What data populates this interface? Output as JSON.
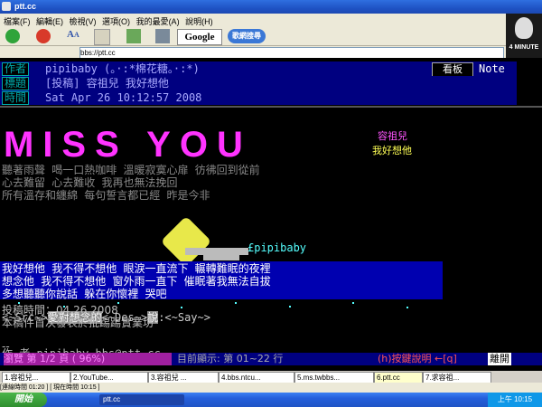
{
  "window": {
    "title": "ptt.cc"
  },
  "menu": [
    "檔案(F)",
    "編輯(E)",
    "檢視(V)",
    "選項(O)",
    "我的最愛(A)",
    "說明(H)"
  ],
  "toolbar": {
    "google": "Google",
    "web_search": "歌網搜尋"
  },
  "address": {
    "value": "bbs://ptt.cc"
  },
  "brand": {
    "text": "4 MINUTE"
  },
  "post": {
    "author_label": "作者",
    "author": "pipibaby (。·:*棉花糖。·:*)",
    "board_button": "看板",
    "board": "Note",
    "title_label": "標題",
    "title": "[投稿] 容祖兒 我好想他",
    "time_label": "時間",
    "time": "Sat Apr 26 10:12:57 2008"
  },
  "art": {
    "big": "MISS YOU",
    "song1": "容祖兒",
    "song2": "我好想他",
    "signature": "£pipibaby",
    "lines": [
      "聽著雨聲   喝一口熱咖啡                    溫暖寂寞心扉   彷彿回到從前",
      "心去難留   心去難收                        我再也無法挽回",
      "所有溫存和纏綿                            每句誓言都已經   昨是今非",
      "我好想他   我不得不想他            眼淚一直流下   輾轉難眠的夜裡",
      "想念他   我不得不想他              窗外雨一直下   催眠著我無法自拔",
      "多想聽聽你說話                                躲在你懷裡   哭吧"
    ]
  },
  "nav": {
    "src": "<~Src~>",
    "selected": "愛對想念的",
    "des": "<~Des~>",
    "say": "說",
    "say_tag": ":<~Say~>"
  },
  "meta": {
    "author_line": "作      者 pipibaby.bbs@ptt.cc",
    "time_line": "投稿時間：04.26.2008",
    "note_line": "本稿件首次發表於批踢踢實業坊",
    "sep": "--"
  },
  "status": {
    "progress": "瀏覽 第 1/2 頁 ( 96%)",
    "range": "目前顯示: 第 01~22 行",
    "help": "(h)按鍵說明 ←[q]",
    "leave": "離開"
  },
  "tabs": [
    "1.容祖兒...",
    "2.YouTube...",
    "3.容祖兒 ...",
    "4.bbs.ntcu...",
    "5.ms.twbbs...",
    "6.ptt.cc",
    "7.求容祖..."
  ],
  "statusline": "[連線時間 01:20 ] [ 現在時間 10:15 ]",
  "taskbar": {
    "start": "開始",
    "task": "ptt.cc",
    "clock": "上午 10:15"
  }
}
